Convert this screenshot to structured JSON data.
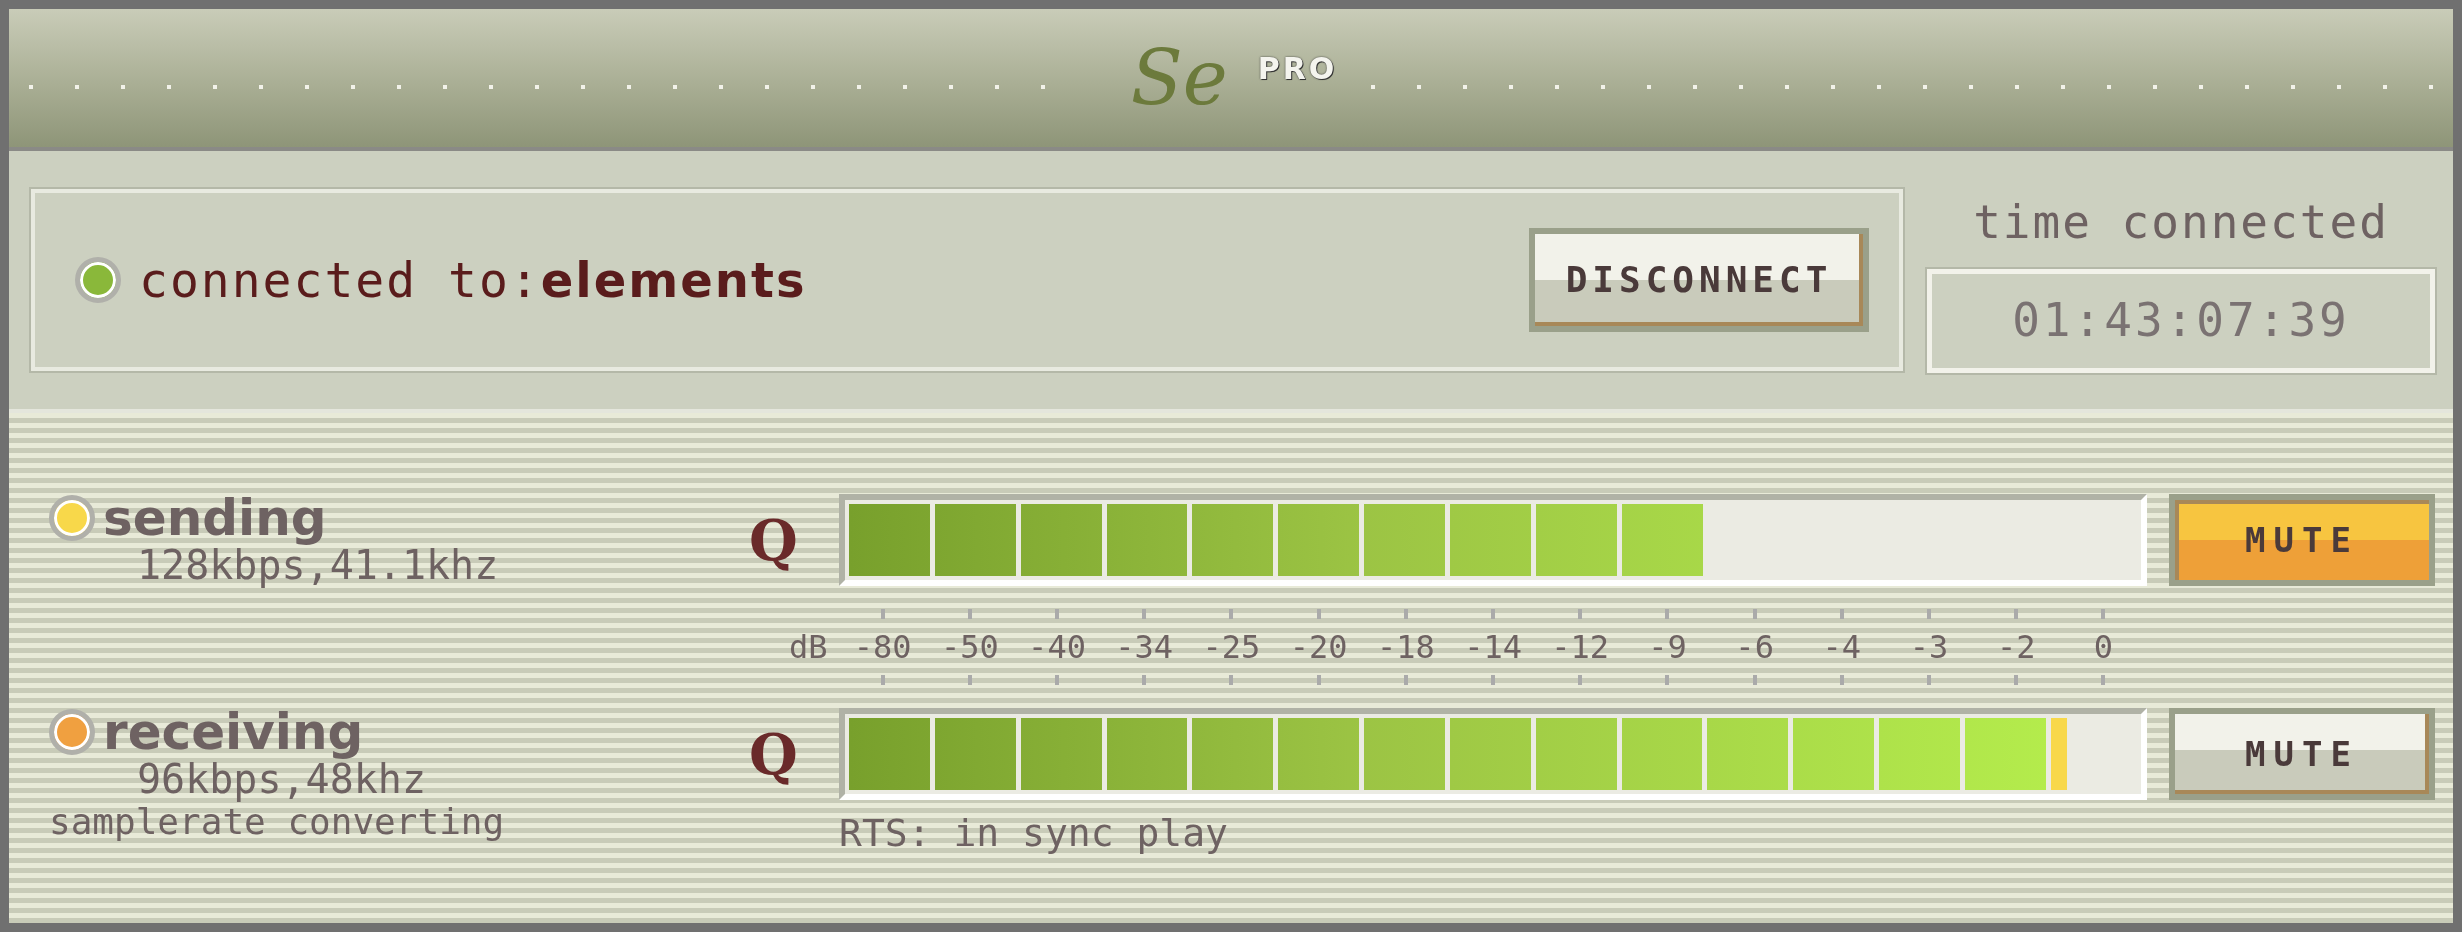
{
  "header": {
    "logo_text": "Se",
    "logo_badge": "PRO"
  },
  "connection": {
    "label": "connected to:",
    "peer": "elements",
    "button": "DISCONNECT"
  },
  "timer": {
    "label": "time connected",
    "value": "01:43:07:39"
  },
  "channels": [
    {
      "name": "sending",
      "color": "#f8d84a",
      "detail": "128kbps,41.1khz",
      "q_label": "Q",
      "level": 0.667,
      "mute_label": "MUTE",
      "muted": true
    },
    {
      "name": "receiving",
      "color": "#f0a040",
      "detail": "96kbps,48khz",
      "q_label": "Q",
      "level": 0.946,
      "mute_label": "MUTE",
      "muted": false
    }
  ],
  "scale": {
    "unit": "dB",
    "ticks": [
      "-80",
      "-50",
      "-40",
      "-34",
      "-25",
      "-20",
      "-18",
      "-14",
      "-12",
      "-9",
      "-6",
      "-4",
      "-3",
      "-2",
      "0"
    ]
  },
  "footer": {
    "note": "samplerate converting",
    "rts": "RTS: in sync play"
  }
}
